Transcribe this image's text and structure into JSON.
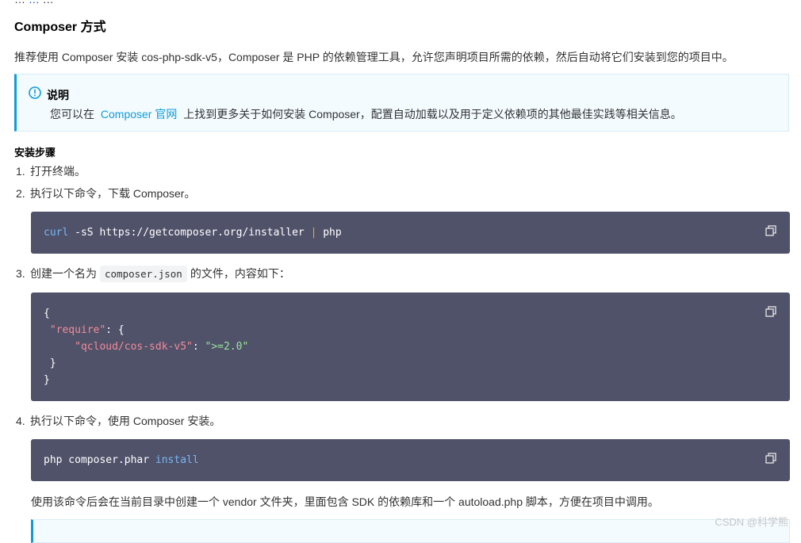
{
  "top_cut": {
    "prefix": "…",
    "link": "…",
    "suffix": "…"
  },
  "section_title": "Composer 方式",
  "intro": "推荐使用 Composer 安装 cos-php-sdk-v5，Composer 是 PHP 的依赖管理工具，允许您声明项目所需的依赖，然后自动将它们安装到您的项目中。",
  "note": {
    "title": "说明",
    "text_before": "您可以在",
    "link": "Composer 官网",
    "text_after": "上找到更多关于如何安装 Composer，配置自动加载以及用于定义依赖项的其他最佳实践等相关信息。"
  },
  "steps_title": "安装步骤",
  "steps": [
    {
      "num": "1.",
      "text": "打开终端。"
    },
    {
      "num": "2.",
      "text": "执行以下命令，下载 Composer。"
    },
    {
      "num": "3.",
      "before": "创建一个名为",
      "code": "composer.json",
      "after": "的文件，内容如下："
    },
    {
      "num": "4.",
      "text": "执行以下命令，使用 Composer 安装。"
    }
  ],
  "code1": {
    "cmd": "curl",
    "args": " -sS https://getcomposer.org/installer ",
    "pipe": "|",
    "tail": " php"
  },
  "code2": {
    "open": "{",
    "key1": "\"require\"",
    "colon1": ": {",
    "key2": "\"qcloud/cos-sdk-v5\"",
    "colon2": ": ",
    "val2": "\">=2.0\"",
    "close1": "}",
    "close2": "}"
  },
  "code3": {
    "cmd": "php composer.phar ",
    "arg": "install"
  },
  "after_install": "使用该命令后会在当前目录中创建一个 vendor 文件夹，里面包含 SDK 的依赖库和一个 autoload.php 脚本，方便在项目中调用。",
  "watermark": "CSDN @科学熊",
  "colors": {
    "accent": "#0f9bd7",
    "code_bg": "#50526a"
  },
  "icons": {
    "note": "info-icon",
    "copy": "copy-icon"
  }
}
